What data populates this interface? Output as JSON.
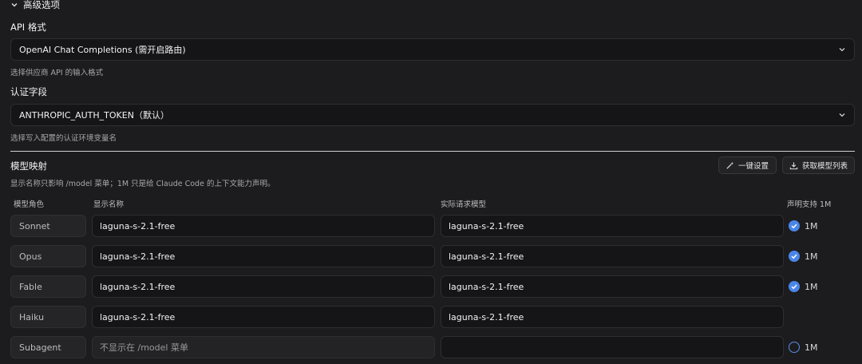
{
  "section": {
    "title": "高级选项"
  },
  "api_format": {
    "label": "API 格式",
    "value": "OpenAI Chat Completions (需开启路由)",
    "hint": "选择供应商 API 的输入格式"
  },
  "auth_field": {
    "label": "认证字段",
    "value": "ANTHROPIC_AUTH_TOKEN（默认）",
    "hint": "选择写入配置的认证环境变量名"
  },
  "model_mapping": {
    "title": "模型映射",
    "hint": "显示名称只影响 /model 菜单；1M 只是给 Claude Code 的上下文能力声明。",
    "one_click_label": "一键设置",
    "fetch_label": "获取模型列表",
    "columns": {
      "role": "模型角色",
      "display": "显示名称",
      "real": "实际请求模型",
      "support": "声明支持 1M"
    },
    "rows": [
      {
        "role": "Sonnet",
        "display": "laguna-s-2.1-free",
        "real": "laguna-s-2.1-free",
        "checked": true,
        "badge": "1M"
      },
      {
        "role": "Opus",
        "display": "laguna-s-2.1-free",
        "real": "laguna-s-2.1-free",
        "checked": true,
        "badge": "1M"
      },
      {
        "role": "Fable",
        "display": "laguna-s-2.1-free",
        "real": "laguna-s-2.1-free",
        "checked": true,
        "badge": "1M"
      },
      {
        "role": "Haiku",
        "display": "laguna-s-2.1-free",
        "real": "laguna-s-2.1-free"
      },
      {
        "role": "Subagent",
        "display_placeholder": "不显示在 /model 菜单",
        "real": "",
        "checked": false,
        "badge": "1M"
      }
    ]
  }
}
